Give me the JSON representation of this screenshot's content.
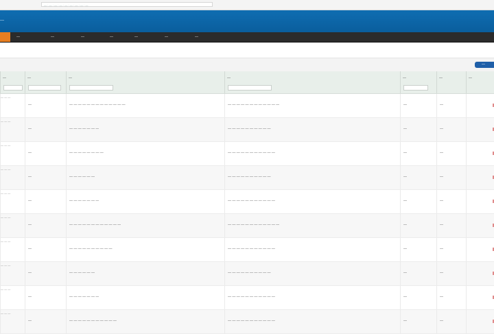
{
  "browser": {
    "url": "— · — · — · — · — · — · — · — · —"
  },
  "app": {
    "title": "—"
  },
  "nav": {
    "items": [
      "—",
      "—",
      "—",
      "—",
      "—",
      "—",
      "—"
    ]
  },
  "toolbar": {
    "button_label": "—"
  },
  "table": {
    "columns": [
      {
        "label": "—"
      },
      {
        "label": "—"
      },
      {
        "label": "—"
      },
      {
        "label": "—"
      },
      {
        "label": "—"
      },
      {
        "label": "—"
      },
      {
        "label": "—"
      }
    ],
    "rows": [
      {
        "id": "— — —",
        "type": "—",
        "name": "— — — — — — — — — — — — —",
        "path": "— — — — — — — — — — — —",
        "date": "—",
        "count": "—"
      },
      {
        "id": "— — —",
        "type": "—",
        "name": "— — — — — — —",
        "path": "— — — — — — — — — —",
        "date": "—",
        "count": "—"
      },
      {
        "id": "— — —",
        "type": "—",
        "name": "— — — — — — — —",
        "path": "— — — — — — — — — — —",
        "date": "—",
        "count": "—"
      },
      {
        "id": "— — —",
        "type": "—",
        "name": "— — — — — —",
        "path": "— — — — — — — — — —",
        "date": "—",
        "count": "—"
      },
      {
        "id": "— — —",
        "type": "—",
        "name": "— — — — — — —",
        "path": "— — — — — — — — — — —",
        "date": "—",
        "count": "—"
      },
      {
        "id": "— — —",
        "type": "—",
        "name": "— — — — — — — — — — — —",
        "path": "— — — — — — — — — — — —",
        "date": "—",
        "count": "—"
      },
      {
        "id": "— — —",
        "type": "—",
        "name": "— — — — — — — — — —",
        "path": "— — — — — — — — — — —",
        "date": "—",
        "count": "—"
      },
      {
        "id": "— — —",
        "type": "—",
        "name": "— — — — — —",
        "path": "— — — — — — — — — —",
        "date": "—",
        "count": "—"
      },
      {
        "id": "— — —",
        "type": "—",
        "name": "— — — — — — —",
        "path": "— — — — — — — — — — —",
        "date": "—",
        "count": "—"
      },
      {
        "id": "— — —",
        "type": "—",
        "name": "— — — — — — — — — — —",
        "path": "— — — — — — — — — — —",
        "date": "—",
        "count": "—"
      }
    ]
  }
}
